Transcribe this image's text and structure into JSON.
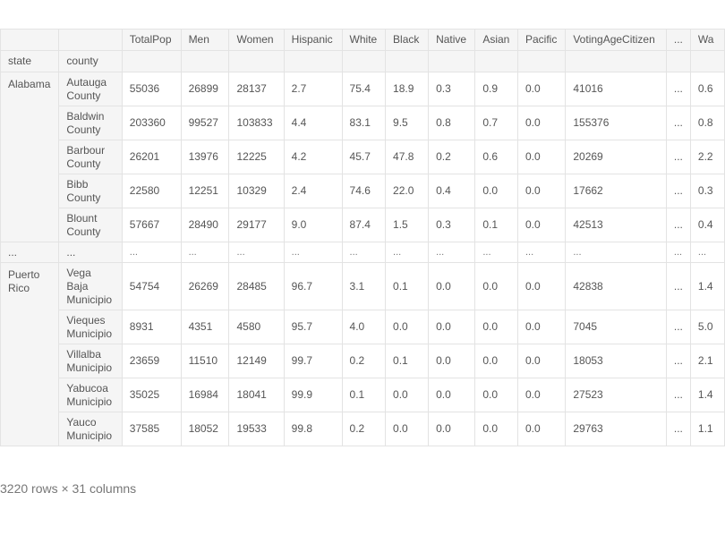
{
  "dataframe": {
    "columns": [
      "TotalPop",
      "Men",
      "Women",
      "Hispanic",
      "White",
      "Black",
      "Native",
      "Asian",
      "Pacific",
      "VotingAgeCitizen",
      "...",
      "Wa"
    ],
    "index_names": [
      "state",
      "county"
    ],
    "ellipsis": "...",
    "groups": [
      {
        "state": "Alabama",
        "rows": [
          {
            "county": "Autauga County",
            "values": [
              "55036",
              "26899",
              "28137",
              "2.7",
              "75.4",
              "18.9",
              "0.3",
              "0.9",
              "0.0",
              "41016",
              "...",
              "0.6"
            ]
          },
          {
            "county": "Baldwin County",
            "values": [
              "203360",
              "99527",
              "103833",
              "4.4",
              "83.1",
              "9.5",
              "0.8",
              "0.7",
              "0.0",
              "155376",
              "...",
              "0.8"
            ]
          },
          {
            "county": "Barbour County",
            "values": [
              "26201",
              "13976",
              "12225",
              "4.2",
              "45.7",
              "47.8",
              "0.2",
              "0.6",
              "0.0",
              "20269",
              "...",
              "2.2"
            ]
          },
          {
            "county": "Bibb County",
            "values": [
              "22580",
              "12251",
              "10329",
              "2.4",
              "74.6",
              "22.0",
              "0.4",
              "0.0",
              "0.0",
              "17662",
              "...",
              "0.3"
            ]
          },
          {
            "county": "Blount County",
            "values": [
              "57667",
              "28490",
              "29177",
              "9.0",
              "87.4",
              "1.5",
              "0.3",
              "0.1",
              "0.0",
              "42513",
              "...",
              "0.4"
            ]
          }
        ]
      },
      {
        "state": "Puerto Rico",
        "rows": [
          {
            "county": "Vega Baja Municipio",
            "values": [
              "54754",
              "26269",
              "28485",
              "96.7",
              "3.1",
              "0.1",
              "0.0",
              "0.0",
              "0.0",
              "42838",
              "...",
              "1.4"
            ]
          },
          {
            "county": "Vieques Municipio",
            "values": [
              "8931",
              "4351",
              "4580",
              "95.7",
              "4.0",
              "0.0",
              "0.0",
              "0.0",
              "0.0",
              "7045",
              "...",
              "5.0"
            ]
          },
          {
            "county": "Villalba Municipio",
            "values": [
              "23659",
              "11510",
              "12149",
              "99.7",
              "0.2",
              "0.1",
              "0.0",
              "0.0",
              "0.0",
              "18053",
              "...",
              "2.1"
            ]
          },
          {
            "county": "Yabucoa Municipio",
            "values": [
              "35025",
              "16984",
              "18041",
              "99.9",
              "0.1",
              "0.0",
              "0.0",
              "0.0",
              "0.0",
              "27523",
              "...",
              "1.4"
            ]
          },
          {
            "county": "Yauco Municipio",
            "values": [
              "37585",
              "18052",
              "19533",
              "99.8",
              "0.2",
              "0.0",
              "0.0",
              "0.0",
              "0.0",
              "29763",
              "...",
              "1.1"
            ]
          }
        ]
      }
    ],
    "shape_text": "3220 rows × 31 columns"
  }
}
